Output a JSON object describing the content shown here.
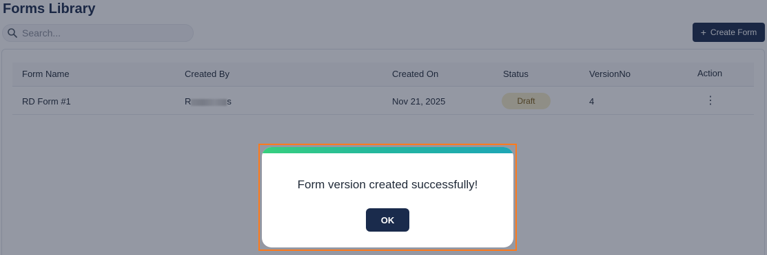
{
  "page": {
    "title": "Forms Library"
  },
  "search": {
    "placeholder": "Search..."
  },
  "toolbar": {
    "create_label": "Create Form"
  },
  "table": {
    "headers": [
      "Form Name",
      "Created By",
      "Created On",
      "Status",
      "VersionNo",
      "Action"
    ],
    "rows": [
      {
        "form_name": "RD Form #1",
        "created_by_prefix": "R",
        "created_by_suffix": "s",
        "created_on": "Nov 21, 2025",
        "status": "Draft",
        "version": "4"
      }
    ]
  },
  "modal": {
    "message": "Form version created successfully!",
    "ok_label": "OK"
  },
  "colors": {
    "primary": "#1a2b4c",
    "draft_badge_bg": "#f6edc8",
    "focus_outline": "#ff7a1a",
    "modal_accent": "#22b5a0"
  }
}
